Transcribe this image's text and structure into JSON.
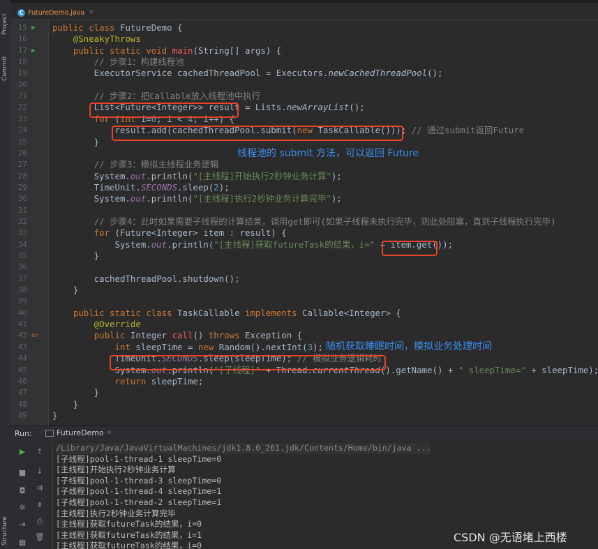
{
  "window": {
    "side_tabs": [
      "Project",
      "Commit",
      "Structure"
    ],
    "file_tab": "FutureDemo.java",
    "file_icon": "C"
  },
  "editor": {
    "lines": [
      {
        "n": "15",
        "m": "run",
        "t": [
          [
            "k",
            "public class "
          ],
          [
            "",
            "FutureDemo {"
          ]
        ]
      },
      {
        "n": "16",
        "t": [
          [
            "",
            "    "
          ],
          [
            "ann",
            "@SneakyThrows"
          ]
        ]
      },
      {
        "n": "17",
        "m": "run",
        "t": [
          [
            "",
            "    "
          ],
          [
            "k",
            "public static void "
          ],
          [
            "fn red",
            "main"
          ],
          [
            "",
            "(String[] args) {"
          ]
        ]
      },
      {
        "n": "18",
        "t": [
          [
            "",
            "        "
          ],
          [
            "cm",
            "// 步骤1：构建线程池"
          ]
        ]
      },
      {
        "n": "19",
        "t": [
          [
            "",
            "        ExecutorService cachedThreadPool = Executors."
          ],
          [
            "it",
            "newCachedThreadPool"
          ],
          [
            "",
            "();"
          ]
        ]
      },
      {
        "n": "20",
        "t": []
      },
      {
        "n": "21",
        "t": [
          [
            "",
            "        "
          ],
          [
            "cm",
            "// 步骤2：把Callable放入线程池中执行"
          ]
        ]
      },
      {
        "n": "22",
        "t": [
          [
            "",
            "        List<Future<Integer>> result = Lists."
          ],
          [
            "it",
            "newArrayList"
          ],
          [
            "",
            "();"
          ]
        ]
      },
      {
        "n": "23",
        "t": [
          [
            "",
            "        "
          ],
          [
            "k",
            "for "
          ],
          [
            "",
            "("
          ],
          [
            "k",
            "int "
          ],
          [
            "",
            "i="
          ],
          [
            "num",
            "0"
          ],
          [
            "",
            "; i < "
          ],
          [
            "num",
            "4"
          ],
          [
            "",
            "; i++) {"
          ]
        ]
      },
      {
        "n": "24",
        "t": [
          [
            "",
            "            result.add(cachedThreadPool.submit("
          ],
          [
            "k",
            "new "
          ],
          [
            "",
            "TaskCallable())); "
          ],
          [
            "cm",
            "// 通过submit返回Future"
          ]
        ]
      },
      {
        "n": "25",
        "t": [
          [
            "",
            "        }"
          ]
        ]
      },
      {
        "n": "26",
        "t": []
      },
      {
        "n": "27",
        "t": [
          [
            "",
            "        "
          ],
          [
            "cm",
            "// 步骤3：模拟主线程业务逻辑"
          ]
        ]
      },
      {
        "n": "28",
        "t": [
          [
            "",
            "        System."
          ],
          [
            "fld",
            "out"
          ],
          [
            "",
            ".println("
          ],
          [
            "str",
            "\"[主线程]开始执行2秒钟业务计算\""
          ],
          [
            "",
            ");"
          ]
        ]
      },
      {
        "n": "29",
        "t": [
          [
            "",
            "        TimeUnit."
          ],
          [
            "fld",
            "SECONDS"
          ],
          [
            "",
            ".sleep("
          ],
          [
            "num",
            "2"
          ],
          [
            "",
            ");"
          ]
        ]
      },
      {
        "n": "30",
        "t": [
          [
            "",
            "        System."
          ],
          [
            "fld",
            "out"
          ],
          [
            "",
            ".println("
          ],
          [
            "str",
            "\"[主线程]执行2秒钟业务计算完毕\""
          ],
          [
            "",
            ");"
          ]
        ]
      },
      {
        "n": "31",
        "t": []
      },
      {
        "n": "32",
        "t": [
          [
            "",
            "        "
          ],
          [
            "cm",
            "// 步骤4：此时如果需要子线程的计算结果，调用get即可(如果子线程未执行完毕，则此处阻塞，直到子线程执行完毕)"
          ]
        ]
      },
      {
        "n": "33",
        "t": [
          [
            "",
            "        "
          ],
          [
            "k",
            "for "
          ],
          [
            "",
            "(Future<Integer> item : result) {"
          ]
        ]
      },
      {
        "n": "34",
        "t": [
          [
            "",
            "            System."
          ],
          [
            "fld",
            "out"
          ],
          [
            "",
            ".println("
          ],
          [
            "str",
            "\"[主线程]获取futureTask的结果，i=\""
          ],
          [
            "",
            " + item.get());"
          ]
        ]
      },
      {
        "n": "35",
        "t": [
          [
            "",
            "        }"
          ]
        ]
      },
      {
        "n": "36",
        "t": []
      },
      {
        "n": "37",
        "t": [
          [
            "",
            "        cachedThreadPool.shutdown();"
          ]
        ]
      },
      {
        "n": "38",
        "t": [
          [
            "",
            "    }"
          ]
        ]
      },
      {
        "n": "39",
        "t": []
      },
      {
        "n": "40",
        "t": [
          [
            "",
            "    "
          ],
          [
            "k",
            "public static class "
          ],
          [
            "",
            "TaskCallable "
          ],
          [
            "k",
            "implements "
          ],
          [
            "",
            "Callable<Integer> {"
          ]
        ]
      },
      {
        "n": "41",
        "t": [
          [
            "",
            "        "
          ],
          [
            "ann",
            "@Override"
          ]
        ]
      },
      {
        "n": "42",
        "m": "impl",
        "t": [
          [
            "",
            "        "
          ],
          [
            "k",
            "public "
          ],
          [
            "",
            "Integer "
          ],
          [
            "fn red",
            "call"
          ],
          [
            "",
            "() "
          ],
          [
            "k",
            "throws "
          ],
          [
            "",
            "Exception {"
          ]
        ]
      },
      {
        "n": "43",
        "t": [
          [
            "",
            "            "
          ],
          [
            "k",
            "int "
          ],
          [
            "",
            "sleepTime = "
          ],
          [
            "k",
            "new "
          ],
          [
            "",
            "Random().nextInt("
          ],
          [
            "num",
            "3"
          ],
          [
            "",
            ");"
          ]
        ]
      },
      {
        "n": "44",
        "t": [
          [
            "",
            "            TimeUnit."
          ],
          [
            "fld",
            "SECONDS"
          ],
          [
            "",
            ".sleep(sleepTime); "
          ],
          [
            "cm",
            "// 模拟业务逻辑耗时"
          ]
        ]
      },
      {
        "n": "45",
        "t": [
          [
            "",
            "            System."
          ],
          [
            "fld",
            "out"
          ],
          [
            "",
            ".println("
          ],
          [
            "str",
            "\"[子线程]\""
          ],
          [
            "",
            " + Thread."
          ],
          [
            "it",
            "currentThread"
          ],
          [
            "",
            "().getName() + "
          ],
          [
            "str",
            "\" sleepTime=\""
          ],
          [
            "",
            " + sleepTime);"
          ]
        ]
      },
      {
        "n": "46",
        "t": [
          [
            "",
            "            "
          ],
          [
            "k",
            "return "
          ],
          [
            "",
            "sleepTime;"
          ]
        ]
      },
      {
        "n": "47",
        "t": [
          [
            "",
            "        }"
          ]
        ]
      },
      {
        "n": "48",
        "t": [
          [
            "",
            "    }"
          ]
        ]
      },
      {
        "n": "49",
        "t": [
          [
            "",
            "}"
          ]
        ]
      }
    ]
  },
  "annotations": {
    "submit_note": "线程池的 submit 方法，可以返回 Future",
    "sleep_note": "随机获取睡眠时间，模拟业务处理时间"
  },
  "run": {
    "label": "Run:",
    "tab": "FutureDemo",
    "output": [
      "/Library/Java/JavaVirtualMachines/jdk1.8.0_261.jdk/Contents/Home/bin/java ...",
      "[子线程]pool-1-thread-1 sleepTime=0",
      "[主线程]开始执行2秒钟业务计算",
      "[子线程]pool-1-thread-3 sleepTime=0",
      "[子线程]pool-1-thread-4 sleepTime=1",
      "[子线程]pool-1-thread-2 sleepTime=1",
      "[主线程]执行2秒钟业务计算完毕",
      "[主线程]获取futureTask的结果，i=0",
      "[主线程]获取futureTask的结果，i=1",
      "[主线程]获取futureTask的结果，i=0"
    ]
  },
  "watermark": "CSDN @无语堵上西楼"
}
